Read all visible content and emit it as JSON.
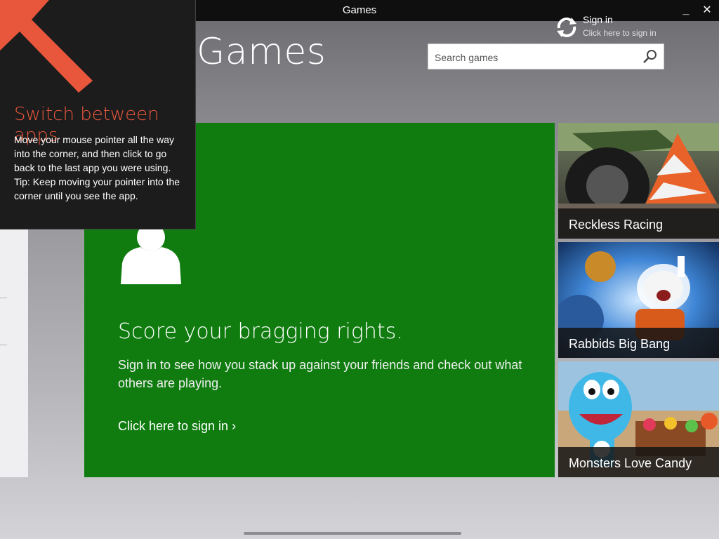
{
  "window": {
    "title": "Games",
    "minimize_glyph": "_",
    "close_glyph": "✕"
  },
  "header": {
    "title": "Games",
    "signin_title": "Sign in",
    "signin_subtitle": "Click here to sign in",
    "search_placeholder": "Search games"
  },
  "hero": {
    "color": "#107c10",
    "headline": "Score your bragging rights.",
    "description": "Sign in to see how you stack up against your friends and check out what others are playing.",
    "cta": "Click here to sign in ›"
  },
  "games": [
    {
      "name": "Reckless Racing"
    },
    {
      "name": "Rabbids Big Bang"
    },
    {
      "name": "Monsters Love Candy"
    }
  ],
  "tip": {
    "accent": "#e8563c",
    "title": "Switch between apps",
    "body_1": "Move your mouse pointer all the way into the corner, and then click to go back to the last app you were using.",
    "body_2": "Tip: Keep moving your pointer into the corner until you see the app."
  }
}
